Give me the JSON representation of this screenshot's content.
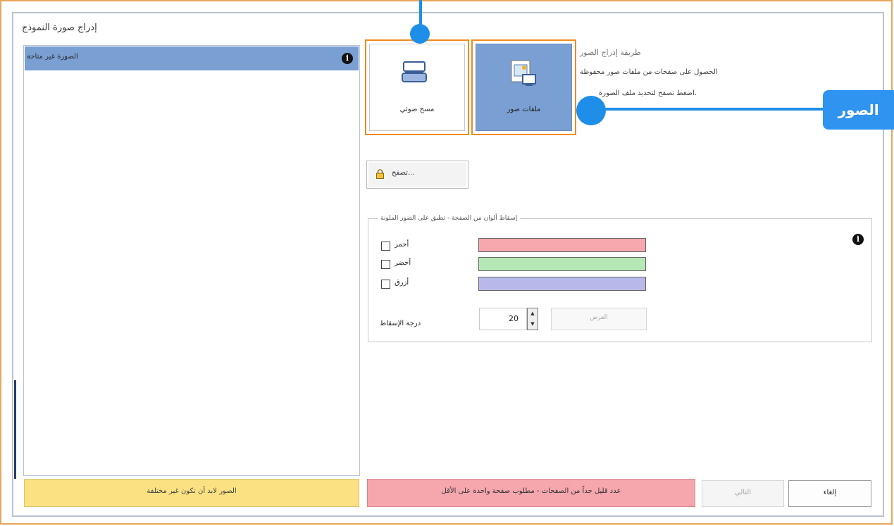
{
  "dialog": {
    "title": "إدراج صورة النموذج"
  },
  "left_panel": {
    "header": "الصورة غير متاحة",
    "footer_warning": "الصور لابد أن تكون غير مختلفة"
  },
  "method": {
    "title": "طريقة إدراج الصور",
    "description_1": "الحصول على صفحات من ملفات صور محفوظة",
    "description_2": "اضغط تصفح لتحديد ملف الصورة.",
    "scanner_label": "مسح ضوئي",
    "files_label": "ملفات صور"
  },
  "callout": {
    "label": "الصور"
  },
  "browse": {
    "label": "تصفح..."
  },
  "color_drop": {
    "group_title": "إسقاط ألوان من الصفحة - تطبق على الصور الملونة",
    "red_label": "أحمر",
    "green_label": "أخضر",
    "blue_label": "أزرق",
    "red_color": "#f7a8ae",
    "green_color": "#b6e8b6",
    "blue_color": "#b8b9ea",
    "drop_level_label": "درجة الإسقاط",
    "drop_level_value": "20",
    "preview_label": "العرض"
  },
  "footer": {
    "error_message": "عدد قليل جداً من الصفحات - مطلوب صفحة واحدة على الأقل",
    "next_label": "التالي",
    "cancel_label": "إلغاء"
  },
  "colors": {
    "accent_orange": "#f08a1e",
    "selected_blue": "#7a9fd3",
    "callout_blue": "#2f93f0"
  }
}
